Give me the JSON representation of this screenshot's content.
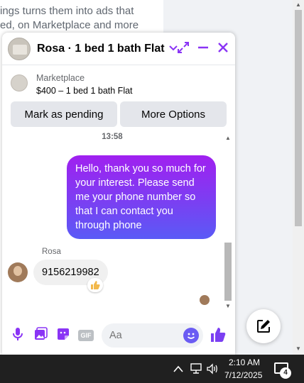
{
  "background": {
    "lines": [
      "ings turns them into ads that",
      "ed, on Marketplace and more"
    ]
  },
  "chat": {
    "title": "Rosa · 1 bed 1 bath Flat",
    "listing": {
      "kind": "Marketplace",
      "name": "$400 – 1 bed 1 bath Flat"
    },
    "actions": {
      "mark_pending": "Mark as pending",
      "more_options": "More Options"
    },
    "timestamp": "13:58",
    "outgoing_message": "Hello, thank you so much for your interest. Please send me your phone number so that I can contact you through phone",
    "incoming_sender": "Rosa",
    "incoming_message": "9156219982",
    "reaction_icon": "thumbs-up",
    "composer": {
      "placeholder": "Aa",
      "gif_label": "GIF"
    },
    "accent_color": "#8a34f5"
  },
  "taskbar": {
    "time": "2:10 AM",
    "date": "7/12/2025",
    "notification_count": "4"
  }
}
